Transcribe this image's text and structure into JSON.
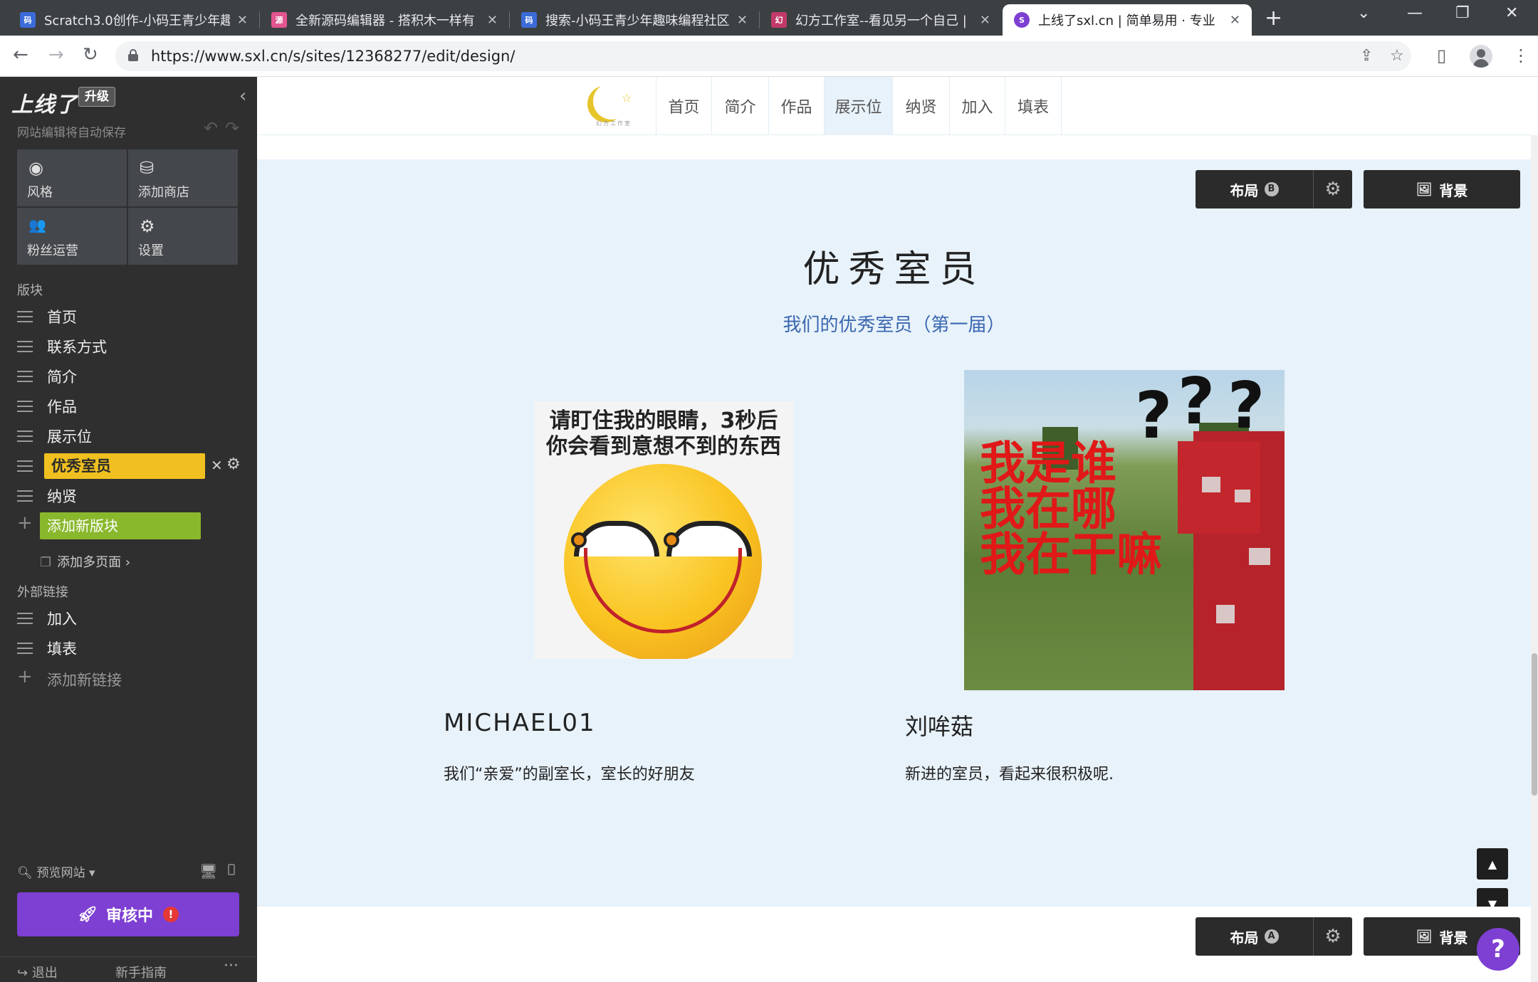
{
  "browser": {
    "tabs": [
      {
        "title": "Scratch3.0创作-小码王青少年趣",
        "favicon": "码",
        "color": "#3b6bd8"
      },
      {
        "title": "全新源码编辑器 - 搭积木一样有",
        "favicon": "源",
        "color": "#e2558f"
      },
      {
        "title": "搜索-小码王青少年趣味编程社区",
        "favicon": "码",
        "color": "#3b6bd8"
      },
      {
        "title": "幻方工作室--看见另一个自己 |",
        "favicon": "幻",
        "color": "#c23a6a"
      },
      {
        "title": "上线了sxl.cn | 简单易用 · 专业",
        "favicon": "S",
        "color": "#7e3fd3"
      }
    ],
    "url": "https://www.sxl.cn/s/sites/12368277/edit/design/",
    "icons": {
      "back": "←",
      "forward": "→",
      "reload": "↻",
      "share": "⇪",
      "bookmark": "☆",
      "sidepanel": "▯",
      "menu": "⋮",
      "newtab": "+",
      "close": "✕"
    }
  },
  "editor": {
    "logo": "上线了",
    "upgrade": "升级",
    "autosave": "网站编辑将自动保存",
    "tiles": [
      {
        "label": "风格",
        "icon": "palette-icon",
        "glyph": "◉"
      },
      {
        "label": "添加商店",
        "icon": "shop-icon",
        "glyph": "⛁"
      },
      {
        "label": "粉丝运营",
        "icon": "users-icon",
        "glyph": "👥"
      },
      {
        "label": "设置",
        "icon": "gear-icon",
        "glyph": "⚙"
      }
    ],
    "blocks_title": "版块",
    "blocks": [
      "首页",
      "联系方式",
      "简介",
      "作品",
      "展示位",
      "优秀室员",
      "纳贤"
    ],
    "selected_block": "优秀室员",
    "add_block": "添加新版块",
    "add_pages": "添加多页面 ›",
    "links_title": "外部链接",
    "links": [
      "加入",
      "填表"
    ],
    "add_link": "添加新链接",
    "preview": "预览网站 ▾",
    "review": "审核中",
    "logout": "退出",
    "guide": "新手指南",
    "more": "···"
  },
  "site": {
    "logo_tag": "幻方工作室",
    "nav": [
      "首页",
      "简介",
      "作品",
      "展示位",
      "纳贤",
      "加入",
      "填表"
    ],
    "active_nav": "展示位",
    "layout_top": "布局",
    "layout_top_badge": "B",
    "layout_bottom": "布局",
    "layout_bottom_badge": "A",
    "background": "背景",
    "section_title": "优秀室员",
    "section_subtitle": "我们的优秀室员（第一届）",
    "members": [
      {
        "name": "MICHAEL01",
        "desc": "我们“亲爱”的副室长，室长的好朋友",
        "image_caption": [
          "请盯住我的眼睛，3秒后",
          "你会看到意想不到的东西"
        ]
      },
      {
        "name": "刘哞菇",
        "desc": "新进的室员，看起来很积极呢.",
        "image_text": [
          "我是谁",
          "我在哪",
          "我在干嘛"
        ]
      }
    ],
    "help": "?"
  },
  "colors": {
    "accent_purple": "#7e3fd3",
    "selected_yellow": "#f0c020",
    "add_green": "#8ab82d",
    "section_bg": "#e8f2fa",
    "subtitle_blue": "#3a67b0"
  }
}
